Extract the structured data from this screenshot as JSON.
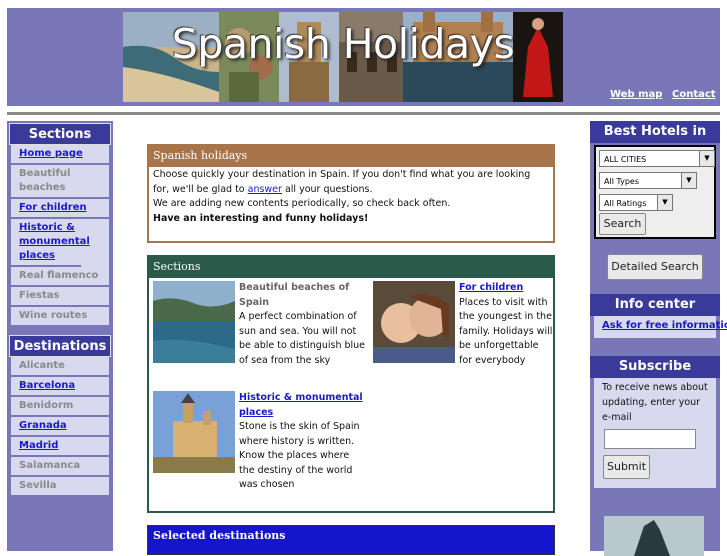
{
  "header": {
    "title": "Spanish Holidays",
    "links": [
      "Web map",
      "Contact"
    ]
  },
  "left_sidebar": {
    "sections_title": "Sections",
    "sections": [
      {
        "label": "Home page",
        "link": true
      },
      {
        "label": "Beautiful beaches",
        "link": false
      },
      {
        "label": "For children",
        "link": true
      },
      {
        "label": "Historic & monumental places",
        "link": true
      },
      {
        "label": "Real flamenco",
        "link": false
      },
      {
        "label": "Fiestas",
        "link": false
      },
      {
        "label": "Wine routes",
        "link": false
      }
    ],
    "destinations_title": "Destinations",
    "destinations": [
      {
        "label": "Alicante",
        "link": false
      },
      {
        "label": "Barcelona",
        "link": true
      },
      {
        "label": "Benidorm",
        "link": false
      },
      {
        "label": "Granada",
        "link": true
      },
      {
        "label": "Madrid",
        "link": true
      },
      {
        "label": "Salamanca",
        "link": false
      },
      {
        "label": "Sevilla",
        "link": false
      }
    ]
  },
  "intro": {
    "title": "Spanish holidays",
    "line1a": "Choose quickly your destination in Spain. If you don't find what you are looking for, we'll be glad to ",
    "link": "answer",
    "line1b": " all your questions.",
    "line2": "We are adding new contents periodically, so check back often.",
    "line3": "Have an interesting and funny holidays!"
  },
  "sections_box": {
    "title": "Sections",
    "items": [
      {
        "title": "Beautiful beaches of Spain",
        "text": "A perfect combination of sun and sea. You will not be able to distinguish blue of sea from the sky",
        "image": "beach-photo"
      },
      {
        "title": "For children",
        "text": "Places to visit with the youngest in the family. Holidays will be unforgettable for everybody",
        "image": "children-photo"
      },
      {
        "title": "Historic & monumental places",
        "text": "Stone is the skin of Spain where history is written. Know the places where the destiny of the world was chosen",
        "image": "castle-photo"
      }
    ]
  },
  "selected": {
    "title": "Selected destinations"
  },
  "right_sidebar": {
    "hotels_title": "Best Hotels in Spain",
    "city_select": "ALL CITIES",
    "type_select": "All Types",
    "rating_select": "All Ratings",
    "search_label": "Search",
    "detailed_search_label": "Detailed Search",
    "info_title": "Info center",
    "info_link": "Ask for free information",
    "subscribe_title": "Subscribe",
    "subscribe_text": "To receive news about updating, enter your e-mail",
    "email_value": "",
    "submit_label": "Submit"
  },
  "colors": {
    "page_band": "#7878b8",
    "header_bar": "#3a3a9a",
    "intro_border": "#a8754a",
    "sections_border": "#2a5a4a",
    "selected_bg": "#1515cc",
    "link": "#1a1acc"
  }
}
